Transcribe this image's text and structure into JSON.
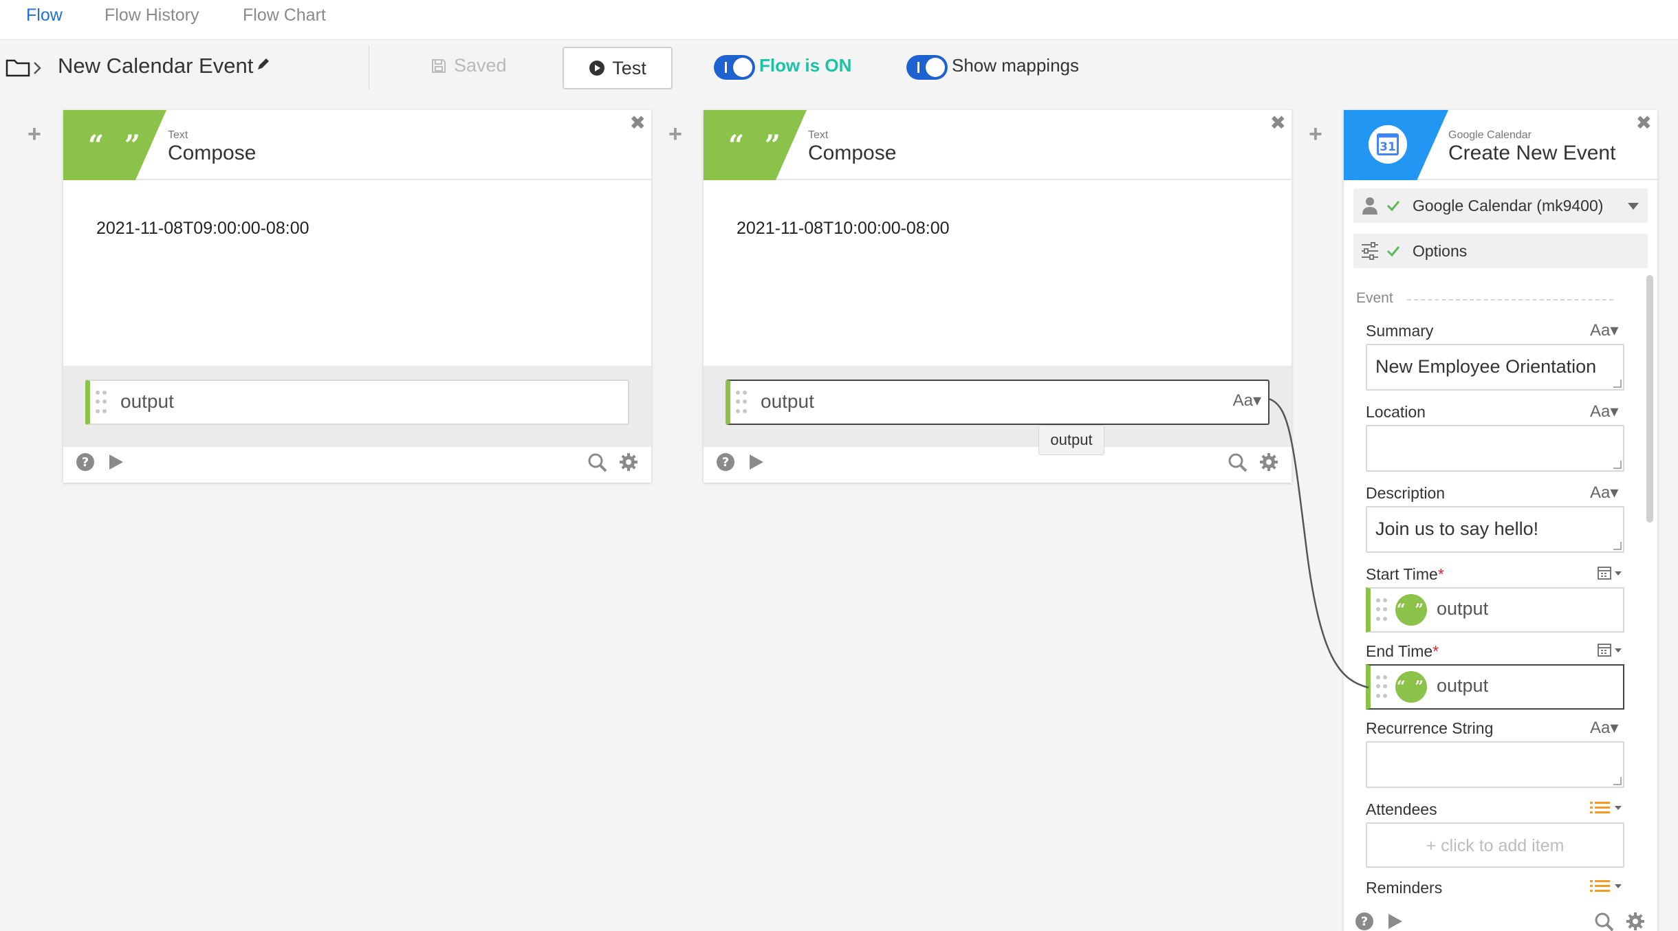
{
  "tabs": [
    {
      "label": "Flow",
      "active": true
    },
    {
      "label": "Flow History",
      "active": false
    },
    {
      "label": "Flow Chart",
      "active": false
    }
  ],
  "toolbar": {
    "flow_name": "New Calendar Event",
    "saved_label": "Saved",
    "test_label": "Test",
    "flow_on_label": "Flow is ON",
    "show_mappings_label": "Show mappings"
  },
  "cards": [
    {
      "app": "Text",
      "action": "Compose",
      "value": "2021-11-08T09:00:00-08:00",
      "output_label": "output"
    },
    {
      "app": "Text",
      "action": "Compose",
      "value": "2021-11-08T10:00:00-08:00",
      "output_label": "output"
    }
  ],
  "tooltip": "output",
  "gcal": {
    "app": "Google Calendar",
    "action": "Create New Event",
    "logo_text": "31",
    "account": "Google Calendar (mk9400)",
    "options_label": "Options",
    "section": "Event",
    "fields": {
      "summary": {
        "label": "Summary",
        "value": "New Employee Orientation",
        "type_label": "Aa"
      },
      "location": {
        "label": "Location",
        "value": "",
        "type_label": "Aa"
      },
      "description": {
        "label": "Description",
        "value": "Join us to say hello!",
        "type_label": "Aa"
      },
      "start_time": {
        "label": "Start Time",
        "required_mark": "*",
        "mapped": "output"
      },
      "end_time": {
        "label": "End Time",
        "required_mark": "*",
        "mapped": "output"
      },
      "recurrence": {
        "label": "Recurrence String",
        "value": "",
        "type_label": "Aa"
      },
      "attendees": {
        "label": "Attendees",
        "placeholder": "+ click to add item"
      },
      "reminders": {
        "label": "Reminders"
      }
    }
  },
  "colors": {
    "accent": "#1e6fd9",
    "toggle": "#1e62d0",
    "flow_on": "#19c3a5",
    "text_badge": "#8bc34a",
    "gcal_badge": "#2196f3",
    "list_icon": "#f59a23",
    "required": "#e0262a"
  }
}
